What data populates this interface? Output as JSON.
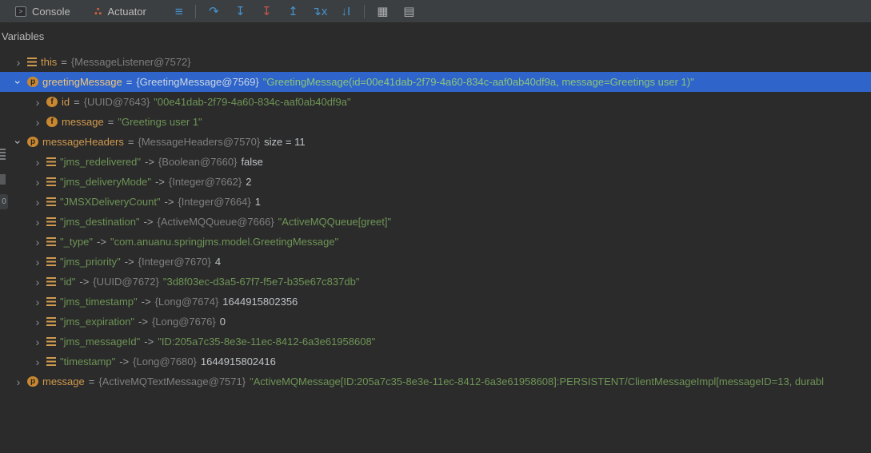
{
  "colors": {
    "bg": "#2b2b2b",
    "toolbar-bg": "#3c3f41",
    "selection": "#2f65ca",
    "name": "#d19a4f",
    "string": "#6e9455",
    "ref": "#7f7f7f",
    "plain": "#bec3c6",
    "header-text": "#bababa",
    "icon-blue": "#4593ce",
    "icon-red": "#c75450",
    "icon-gray": "#aeb0b2",
    "actuator-orange": "#e2633e"
  },
  "toolbar": {
    "tabs": [
      {
        "label": "Console",
        "icon_glyph": ">"
      },
      {
        "label": "Actuator",
        "icon_glyph": "∴"
      }
    ],
    "icons": [
      {
        "name": "menu",
        "glyph": "≡"
      },
      {
        "name": "step-over",
        "glyph": "↷"
      },
      {
        "name": "step-into",
        "glyph": "↧"
      },
      {
        "name": "force-step-into",
        "glyph": "↧"
      },
      {
        "name": "step-out",
        "glyph": "↥"
      },
      {
        "name": "drop-frame",
        "glyph": "↴x"
      },
      {
        "name": "run-to-cursor",
        "glyph": "↓I"
      },
      {
        "name": "view-as-table",
        "glyph": "▦"
      },
      {
        "name": "layout-settings",
        "glyph": "▤"
      }
    ]
  },
  "panel": {
    "title": "Variables"
  },
  "stripe": {
    "badge": "0"
  },
  "glyphs": {
    "chevron": "›",
    "p": "p",
    "f": "f"
  },
  "tree": {
    "rows": [
      {
        "kind": "var",
        "level": 0,
        "expanded": false,
        "selected": false,
        "icon": "bars",
        "name": "this",
        "sep": "=",
        "ref": "{MessageListener@7572}",
        "value": "",
        "plain": ""
      },
      {
        "kind": "var",
        "level": 0,
        "expanded": true,
        "selected": true,
        "icon": "p",
        "name": "greetingMessage",
        "sep": "=",
        "ref": "{GreetingMessage@7569}",
        "value": "\"GreetingMessage(id=00e41dab-2f79-4a60-834c-aaf0ab40df9a, message=Greetings user 1)\"",
        "plain": ""
      },
      {
        "kind": "var",
        "level": 1,
        "expanded": false,
        "selected": false,
        "icon": "f",
        "name": "id",
        "sep": "=",
        "ref": "{UUID@7643}",
        "value": "\"00e41dab-2f79-4a60-834c-aaf0ab40df9a\"",
        "plain": ""
      },
      {
        "kind": "var",
        "level": 1,
        "expanded": false,
        "selected": false,
        "icon": "f",
        "name": "message",
        "sep": "=",
        "ref": "",
        "value": "\"Greetings user 1\"",
        "plain": ""
      },
      {
        "kind": "var",
        "level": 0,
        "expanded": true,
        "selected": false,
        "icon": "p",
        "name": "messageHeaders",
        "sep": "=",
        "ref": "{MessageHeaders@7570}",
        "value": "",
        "plain": "size = 11"
      },
      {
        "kind": "entry",
        "level": 1,
        "expanded": false,
        "selected": false,
        "icon": "bars",
        "name": "\"jms_redelivered\"",
        "sep": "->",
        "ref": "{Boolean@7660}",
        "value": "",
        "plain": "false"
      },
      {
        "kind": "entry",
        "level": 1,
        "expanded": false,
        "selected": false,
        "icon": "bars",
        "name": "\"jms_deliveryMode\"",
        "sep": "->",
        "ref": "{Integer@7662}",
        "value": "",
        "plain": "2"
      },
      {
        "kind": "entry",
        "level": 1,
        "expanded": false,
        "selected": false,
        "icon": "bars",
        "name": "\"JMSXDeliveryCount\"",
        "sep": "->",
        "ref": "{Integer@7664}",
        "value": "",
        "plain": "1"
      },
      {
        "kind": "entry",
        "level": 1,
        "expanded": false,
        "selected": false,
        "icon": "bars",
        "name": "\"jms_destination\"",
        "sep": "->",
        "ref": "{ActiveMQQueue@7666}",
        "value": "\"ActiveMQQueue[greet]\"",
        "plain": ""
      },
      {
        "kind": "entry",
        "level": 1,
        "expanded": false,
        "selected": false,
        "icon": "bars",
        "name": "\"_type\"",
        "sep": "->",
        "ref": "",
        "value": "\"com.anuanu.springjms.model.GreetingMessage\"",
        "plain": ""
      },
      {
        "kind": "entry",
        "level": 1,
        "expanded": false,
        "selected": false,
        "icon": "bars",
        "name": "\"jms_priority\"",
        "sep": "->",
        "ref": "{Integer@7670}",
        "value": "",
        "plain": "4"
      },
      {
        "kind": "entry",
        "level": 1,
        "expanded": false,
        "selected": false,
        "icon": "bars",
        "name": "\"id\"",
        "sep": "->",
        "ref": "{UUID@7672}",
        "value": "\"3d8f03ec-d3a5-67f7-f5e7-b35e67c837db\"",
        "plain": ""
      },
      {
        "kind": "entry",
        "level": 1,
        "expanded": false,
        "selected": false,
        "icon": "bars",
        "name": "\"jms_timestamp\"",
        "sep": "->",
        "ref": "{Long@7674}",
        "value": "",
        "plain": "1644915802356"
      },
      {
        "kind": "entry",
        "level": 1,
        "expanded": false,
        "selected": false,
        "icon": "bars",
        "name": "\"jms_expiration\"",
        "sep": "->",
        "ref": "{Long@7676}",
        "value": "",
        "plain": "0"
      },
      {
        "kind": "entry",
        "level": 1,
        "expanded": false,
        "selected": false,
        "icon": "bars",
        "name": "\"jms_messageId\"",
        "sep": "->",
        "ref": "",
        "value": "\"ID:205a7c35-8e3e-11ec-8412-6a3e61958608\"",
        "plain": ""
      },
      {
        "kind": "entry",
        "level": 1,
        "expanded": false,
        "selected": false,
        "icon": "bars",
        "name": "\"timestamp\"",
        "sep": "->",
        "ref": "{Long@7680}",
        "value": "",
        "plain": "1644915802416"
      },
      {
        "kind": "var",
        "level": 0,
        "expanded": false,
        "selected": false,
        "icon": "p",
        "name": "message",
        "sep": "=",
        "ref": "{ActiveMQTextMessage@7571}",
        "value": "\"ActiveMQMessage[ID:205a7c35-8e3e-11ec-8412-6a3e61958608]:PERSISTENT/ClientMessageImpl[messageID=13, durabl",
        "plain": ""
      }
    ]
  }
}
